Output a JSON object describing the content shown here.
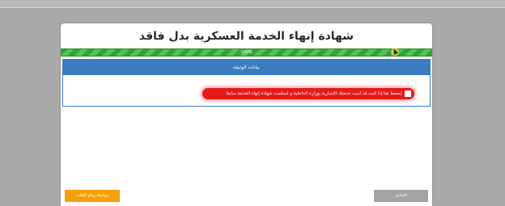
{
  "form": {
    "title": "شهادة إنهاء الخدمة العسكرية بدل فاقد",
    "progress": {
      "label": "100%",
      "percent": 100
    },
    "section": {
      "header": "بيانات الوثيقة",
      "checkbox_label": "إضغط هنا إذا كنت قد أديت خدمتك الإجبارية بوزارة الداخلية و استلمت شهادة إنهاء الخدمة سابقاً",
      "checked": false
    },
    "buttons": {
      "previous": "السابق",
      "contact": "مراسلة وتكو الطلب"
    }
  },
  "colors": {
    "progress_green": "#3db03d",
    "panel_blue": "#3a7cbf",
    "alert_red": "#e51b1b",
    "contact_orange": "#f5a009",
    "previous_gray": "#a3a3a3"
  }
}
